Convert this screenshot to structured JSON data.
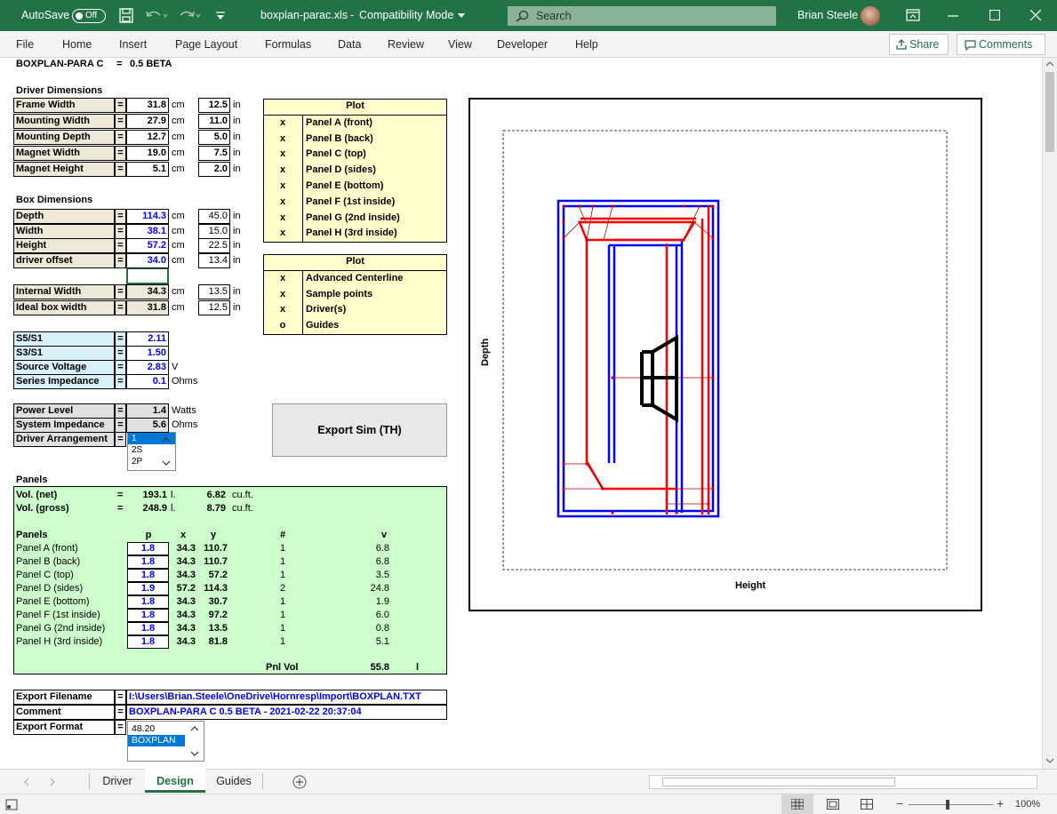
{
  "titlebar": {
    "autosave": "AutoSave",
    "toggle": "Off",
    "filename": "boxplan-parac.xls",
    "sep": "-",
    "mode": "Compatibility Mode",
    "search_placeholder": "Search",
    "user": "Brian Steele"
  },
  "menu": {
    "items": [
      "File",
      "Home",
      "Insert",
      "Page Layout",
      "Formulas",
      "Data",
      "Review",
      "View",
      "Developer",
      "Help"
    ],
    "share": "Share",
    "comments": "Comments"
  },
  "sheet": {
    "title": "BOXPLAN-PARA C",
    "title_eq": "=",
    "title_val": "0.5 BETA",
    "driver_dims": {
      "header": "Driver Dimensions",
      "rows": [
        {
          "label": "Frame Width",
          "cm": "31.8",
          "in": "12.5"
        },
        {
          "label": "Mounting Width",
          "cm": "27.9",
          "in": "11.0"
        },
        {
          "label": "Mounting Depth",
          "cm": "12.7",
          "in": "5.0"
        },
        {
          "label": "Magnet Width",
          "cm": "19.0",
          "in": "7.5"
        },
        {
          "label": "Magnet Height",
          "cm": "5.1",
          "in": "2.0"
        }
      ]
    },
    "box_dims": {
      "header": "Box Dimensions",
      "rows": [
        {
          "label": "Depth",
          "cm": "114.3",
          "in": "45.0"
        },
        {
          "label": "Width",
          "cm": "38.1",
          "in": "15.0"
        },
        {
          "label": "Height",
          "cm": "57.2",
          "in": "22.5"
        },
        {
          "label": "driver offset",
          "cm": "34.0",
          "in": "13.4"
        }
      ],
      "rows2": [
        {
          "label": "Internal Width",
          "cm": "34.3",
          "in": "13.5"
        },
        {
          "label": "Ideal box width",
          "cm": "31.8",
          "in": "12.5"
        }
      ]
    },
    "units": {
      "cm": "cm",
      "in": "in",
      "eq": "="
    },
    "ratios": [
      {
        "label": "S5/S1",
        "value": "2.11",
        "unit": ""
      },
      {
        "label": "S3/S1",
        "value": "1.50",
        "unit": ""
      },
      {
        "label": "Source Voltage",
        "value": "2.83",
        "unit": "V"
      },
      {
        "label": "Series Impedance",
        "value": "0.1",
        "unit": "Ohms"
      }
    ],
    "power": [
      {
        "label": "Power Level",
        "value": "1.4",
        "unit": "Watts"
      },
      {
        "label": "System Impedance",
        "value": "5.6",
        "unit": "Ohms"
      },
      {
        "label": "Driver Arrangement",
        "value": "",
        "unit": ""
      }
    ],
    "arrangement_options": [
      "1",
      "2S",
      "2P"
    ],
    "plot1": {
      "header": "Plot",
      "rows": [
        {
          "mark": "x",
          "label": "Panel A (front)"
        },
        {
          "mark": "x",
          "label": "Panel B (back)"
        },
        {
          "mark": "x",
          "label": "Panel C (top)"
        },
        {
          "mark": "x",
          "label": "Panel D (sides)"
        },
        {
          "mark": "x",
          "label": "Panel E (bottom)"
        },
        {
          "mark": "x",
          "label": "Panel F (1st inside)"
        },
        {
          "mark": "x",
          "label": "Panel G (2nd inside)"
        },
        {
          "mark": "x",
          "label": "Panel H (3rd inside)"
        }
      ]
    },
    "plot2": {
      "header": "Plot",
      "rows": [
        {
          "mark": "x",
          "label": "Advanced Centerline"
        },
        {
          "mark": "x",
          "label": "Sample points"
        },
        {
          "mark": "x",
          "label": "Driver(s)"
        },
        {
          "mark": "o",
          "label": "Guides"
        }
      ]
    },
    "export_button": "Export Sim (TH)",
    "panels": {
      "header": "Panels",
      "vol": [
        {
          "label": "Vol. (net)",
          "eq": "=",
          "l": "193.1",
          "lu": "l.",
          "cuft": "6.82",
          "cu": "cu.ft."
        },
        {
          "label": "Vol. (gross)",
          "eq": "=",
          "l": "248.9",
          "lu": "l.",
          "cuft": "8.79",
          "cu": "cu.ft."
        }
      ],
      "cols": {
        "name": "Panels",
        "p": "p",
        "x": "x",
        "y": "y",
        "n": "#",
        "v": "v"
      },
      "rows": [
        {
          "name": "Panel A (front)",
          "p": "1.8",
          "x": "34.3",
          "y": "110.7",
          "n": "1",
          "v": "6.8"
        },
        {
          "name": "Panel B (back)",
          "p": "1.8",
          "x": "34.3",
          "y": "110.7",
          "n": "1",
          "v": "6.8"
        },
        {
          "name": "Panel C (top)",
          "p": "1.8",
          "x": "34.3",
          "y": "57.2",
          "n": "1",
          "v": "3.5"
        },
        {
          "name": "Panel D (sides)",
          "p": "1.9",
          "x": "57.2",
          "y": "114.3",
          "n": "2",
          "v": "24.8"
        },
        {
          "name": "Panel E (bottom)",
          "p": "1.8",
          "x": "34.3",
          "y": "30.7",
          "n": "1",
          "v": "1.9"
        },
        {
          "name": "Panel F (1st inside)",
          "p": "1.8",
          "x": "34.3",
          "y": "97.2",
          "n": "1",
          "v": "6.0"
        },
        {
          "name": "Panel G (2nd inside)",
          "p": "1.8",
          "x": "34.3",
          "y": "13.5",
          "n": "1",
          "v": "0.8"
        },
        {
          "name": "Panel H (3rd inside)",
          "p": "1.8",
          "x": "34.3",
          "y": "81.8",
          "n": "1",
          "v": "5.1"
        }
      ],
      "pnl_vol_label": "Pnl Vol",
      "pnl_vol": "55.8",
      "pnl_vol_unit": "l"
    },
    "export": [
      {
        "label": "Export Filename",
        "value": "I:\\Users\\Brian.Steele\\OneDrive\\Hornresp\\Import\\BOXPLAN.TXT"
      },
      {
        "label": "Comment",
        "value": "BOXPLAN-PARA C 0.5 BETA - 2021-02-22 20:37:04"
      },
      {
        "label": "Export Format",
        "value": ""
      }
    ],
    "format_options": [
      "48.20",
      "BOXPLAN"
    ],
    "diagram": {
      "y_label": "Depth",
      "x_label": "Height"
    }
  },
  "tabs": {
    "items": [
      "Driver",
      "Design",
      "Guides"
    ],
    "active": "Design"
  },
  "status": {
    "zoom": "100%"
  },
  "colors": {
    "excel_green": "#217346",
    "panel_blue": "#0000ff",
    "panel_red": "#ff0000",
    "driver": "#000000"
  }
}
